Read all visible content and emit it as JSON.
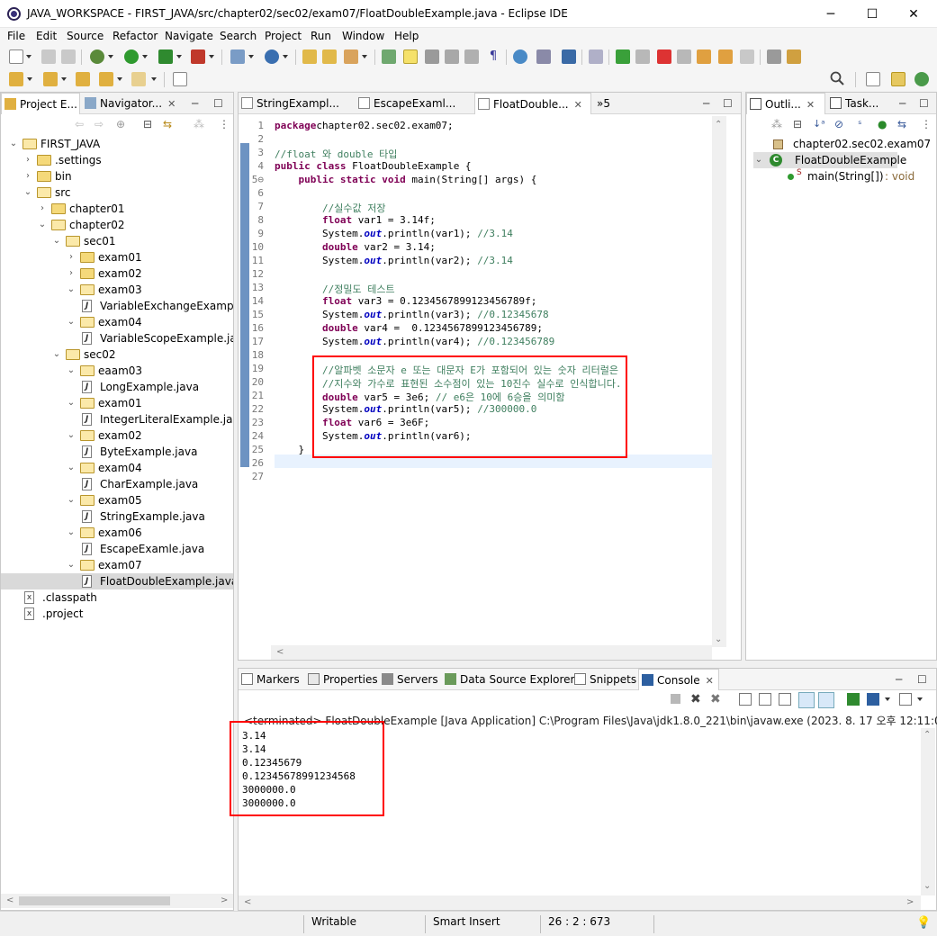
{
  "window": {
    "title": "JAVA_WORKSPACE - FIRST_JAVA/src/chapter02/sec02/exam07/FloatDoubleExample.java - Eclipse IDE",
    "minimize": "─",
    "maximize": "☐",
    "close": "✕"
  },
  "menu": [
    "File",
    "Edit",
    "Source",
    "Refactor",
    "Navigate",
    "Search",
    "Project",
    "Run",
    "Window",
    "Help"
  ],
  "left_panel": {
    "tabs": [
      {
        "label": "Project E..."
      },
      {
        "label": "Navigator..."
      }
    ],
    "tree": [
      {
        "label": "FIRST_JAVA",
        "depth": 0,
        "type": "project",
        "expanded": true
      },
      {
        "label": ".settings",
        "depth": 1,
        "type": "folder",
        "expanded": false
      },
      {
        "label": "bin",
        "depth": 1,
        "type": "folder",
        "expanded": false
      },
      {
        "label": "src",
        "depth": 1,
        "type": "folder",
        "expanded": true
      },
      {
        "label": "chapter01",
        "depth": 2,
        "type": "folder",
        "expanded": false
      },
      {
        "label": "chapter02",
        "depth": 2,
        "type": "folder",
        "expanded": true
      },
      {
        "label": "sec01",
        "depth": 3,
        "type": "folder",
        "expanded": true
      },
      {
        "label": "exam01",
        "depth": 4,
        "type": "folder",
        "expanded": false
      },
      {
        "label": "exam02",
        "depth": 4,
        "type": "folder",
        "expanded": false
      },
      {
        "label": "exam03",
        "depth": 4,
        "type": "folder",
        "expanded": true
      },
      {
        "label": "VariableExchangeExampl",
        "depth": 5,
        "type": "java"
      },
      {
        "label": "exam04",
        "depth": 4,
        "type": "folder",
        "expanded": true
      },
      {
        "label": "VariableScopeExample.ja",
        "depth": 5,
        "type": "java"
      },
      {
        "label": "sec02",
        "depth": 3,
        "type": "folder",
        "expanded": true
      },
      {
        "label": "eaam03",
        "depth": 4,
        "type": "folder",
        "expanded": true
      },
      {
        "label": "LongExample.java",
        "depth": 5,
        "type": "java"
      },
      {
        "label": "exam01",
        "depth": 4,
        "type": "folder",
        "expanded": true
      },
      {
        "label": "IntegerLiteralExample.java",
        "depth": 5,
        "type": "java"
      },
      {
        "label": "exam02",
        "depth": 4,
        "type": "folder",
        "expanded": true
      },
      {
        "label": "ByteExample.java",
        "depth": 5,
        "type": "java"
      },
      {
        "label": "exam04",
        "depth": 4,
        "type": "folder",
        "expanded": true
      },
      {
        "label": "CharExample.java",
        "depth": 5,
        "type": "java"
      },
      {
        "label": "exam05",
        "depth": 4,
        "type": "folder",
        "expanded": true
      },
      {
        "label": "StringExample.java",
        "depth": 5,
        "type": "java"
      },
      {
        "label": "exam06",
        "depth": 4,
        "type": "folder",
        "expanded": true
      },
      {
        "label": "EscapeExamle.java",
        "depth": 5,
        "type": "java"
      },
      {
        "label": "exam07",
        "depth": 4,
        "type": "folder",
        "expanded": true
      },
      {
        "label": "FloatDoubleExample.java",
        "depth": 5,
        "type": "java",
        "selected": true
      },
      {
        "label": ".classpath",
        "depth": 1,
        "type": "xml"
      },
      {
        "label": ".project",
        "depth": 1,
        "type": "xml"
      }
    ]
  },
  "editor": {
    "tabs": [
      {
        "label": "StringExampl..."
      },
      {
        "label": "EscapeExaml..."
      },
      {
        "label": "FloatDouble..."
      }
    ],
    "overflow": "»5",
    "lines": [
      {
        "n": "1",
        "t": [
          [
            "kw",
            "package"
          ],
          [
            "",
            "chapter02.sec02.exam07;"
          ]
        ]
      },
      {
        "n": "2",
        "t": []
      },
      {
        "n": "3",
        "t": [
          [
            "cm",
            "//float 와 double 타입"
          ]
        ]
      },
      {
        "n": "4",
        "t": [
          [
            "kw",
            "public class"
          ],
          [
            "",
            " FloatDoubleExample {"
          ]
        ]
      },
      {
        "n": "5⊖",
        "t": [
          [
            "",
            "    "
          ],
          [
            "kw",
            "public static void"
          ],
          [
            "",
            " main(String[] args) {"
          ]
        ]
      },
      {
        "n": "6",
        "t": []
      },
      {
        "n": "7",
        "t": [
          [
            "",
            "        "
          ],
          [
            "cm",
            "//실수값 저장"
          ]
        ]
      },
      {
        "n": "8",
        "t": [
          [
            "",
            "        "
          ],
          [
            "kw",
            "float"
          ],
          [
            "",
            " var1 = 3.14f;"
          ]
        ]
      },
      {
        "n": "9",
        "t": [
          [
            "",
            "        System."
          ],
          [
            "fld",
            "out"
          ],
          [
            "",
            ".println(var1); "
          ],
          [
            "cm",
            "//3.14"
          ]
        ]
      },
      {
        "n": "10",
        "t": [
          [
            "",
            "        "
          ],
          [
            "kw",
            "double"
          ],
          [
            "",
            " var2 = 3.14;"
          ]
        ]
      },
      {
        "n": "11",
        "t": [
          [
            "",
            "        System."
          ],
          [
            "fld",
            "out"
          ],
          [
            "",
            ".println(var2); "
          ],
          [
            "cm",
            "//3.14"
          ]
        ]
      },
      {
        "n": "12",
        "t": []
      },
      {
        "n": "13",
        "t": [
          [
            "",
            "        "
          ],
          [
            "cm",
            "//정밀도 테스트"
          ]
        ]
      },
      {
        "n": "14",
        "t": [
          [
            "",
            "        "
          ],
          [
            "kw",
            "float"
          ],
          [
            "",
            " var3 = 0.1234567899123456789f;"
          ]
        ]
      },
      {
        "n": "15",
        "t": [
          [
            "",
            "        System."
          ],
          [
            "fld",
            "out"
          ],
          [
            "",
            ".println(var3); "
          ],
          [
            "cm",
            "//0.12345678"
          ]
        ]
      },
      {
        "n": "16",
        "t": [
          [
            "",
            "        "
          ],
          [
            "kw",
            "double"
          ],
          [
            "",
            " var4 =  0.1234567899123456789;"
          ]
        ]
      },
      {
        "n": "17",
        "t": [
          [
            "",
            "        System."
          ],
          [
            "fld",
            "out"
          ],
          [
            "",
            ".println(var4); "
          ],
          [
            "cm",
            "//0.123456789"
          ]
        ]
      },
      {
        "n": "18",
        "t": []
      },
      {
        "n": "19",
        "t": [
          [
            "",
            "        "
          ],
          [
            "cm",
            "//알파벳 소문자 e 또는 대문자 E가 포함되어 있는 숫자 리터럴은"
          ]
        ]
      },
      {
        "n": "20",
        "t": [
          [
            "",
            "        "
          ],
          [
            "cm",
            "//지수와 가수로 표현된 소수점이 있는 10진수 실수로 인식합니다."
          ]
        ]
      },
      {
        "n": "21",
        "t": [
          [
            "",
            "        "
          ],
          [
            "kw",
            "double"
          ],
          [
            "",
            " var5 = 3e6; "
          ],
          [
            "cm",
            "// e6은 10에 6승을 의미함"
          ]
        ]
      },
      {
        "n": "22",
        "t": [
          [
            "",
            "        System."
          ],
          [
            "fld",
            "out"
          ],
          [
            "",
            ".println(var5); "
          ],
          [
            "cm",
            "//300000.0"
          ]
        ]
      },
      {
        "n": "23",
        "t": [
          [
            "",
            "        "
          ],
          [
            "kw",
            "float"
          ],
          [
            "",
            " var6 = 3e6F;"
          ]
        ]
      },
      {
        "n": "24",
        "t": [
          [
            "",
            "        System."
          ],
          [
            "fld",
            "out"
          ],
          [
            "",
            ".println(var6);"
          ]
        ]
      },
      {
        "n": "25",
        "t": [
          [
            "",
            "    }"
          ]
        ]
      },
      {
        "n": "26",
        "t": [
          [
            "",
            "}"
          ]
        ]
      },
      {
        "n": "27",
        "t": []
      }
    ]
  },
  "outline": {
    "tabs": [
      {
        "label": "Outli..."
      },
      {
        "label": "Task..."
      }
    ],
    "items": [
      {
        "label": "chapter02.sec02.exam07",
        "depth": 0
      },
      {
        "label": "FloatDoubleExample",
        "depth": 0,
        "selected": true
      },
      {
        "label": "main(String[])",
        "suffix": " : void",
        "depth": 1
      }
    ]
  },
  "bottom": {
    "tabs": [
      {
        "label": "Markers"
      },
      {
        "label": "Properties"
      },
      {
        "label": "Servers"
      },
      {
        "label": "Data Source Explorer"
      },
      {
        "label": "Snippets"
      },
      {
        "label": "Console"
      }
    ],
    "header": "<terminated> FloatDoubleExample [Java Application] C:\\Program Files\\Java\\jdk1.8.0_221\\bin\\javaw.exe  (2023. 8. 17 오후 12:11:03 – 오후",
    "output": [
      "3.14",
      "3.14",
      "0.12345679",
      "0.12345678991234568",
      "3000000.0",
      "3000000.0"
    ]
  },
  "status": {
    "writable": "Writable",
    "insert": "Smart Insert",
    "position": "26 : 2 : 673"
  },
  "colors": {
    "highlight": "#ff0000",
    "keyword": "#7f0055",
    "comment": "#3f7f5f",
    "field": "#0000c0"
  }
}
